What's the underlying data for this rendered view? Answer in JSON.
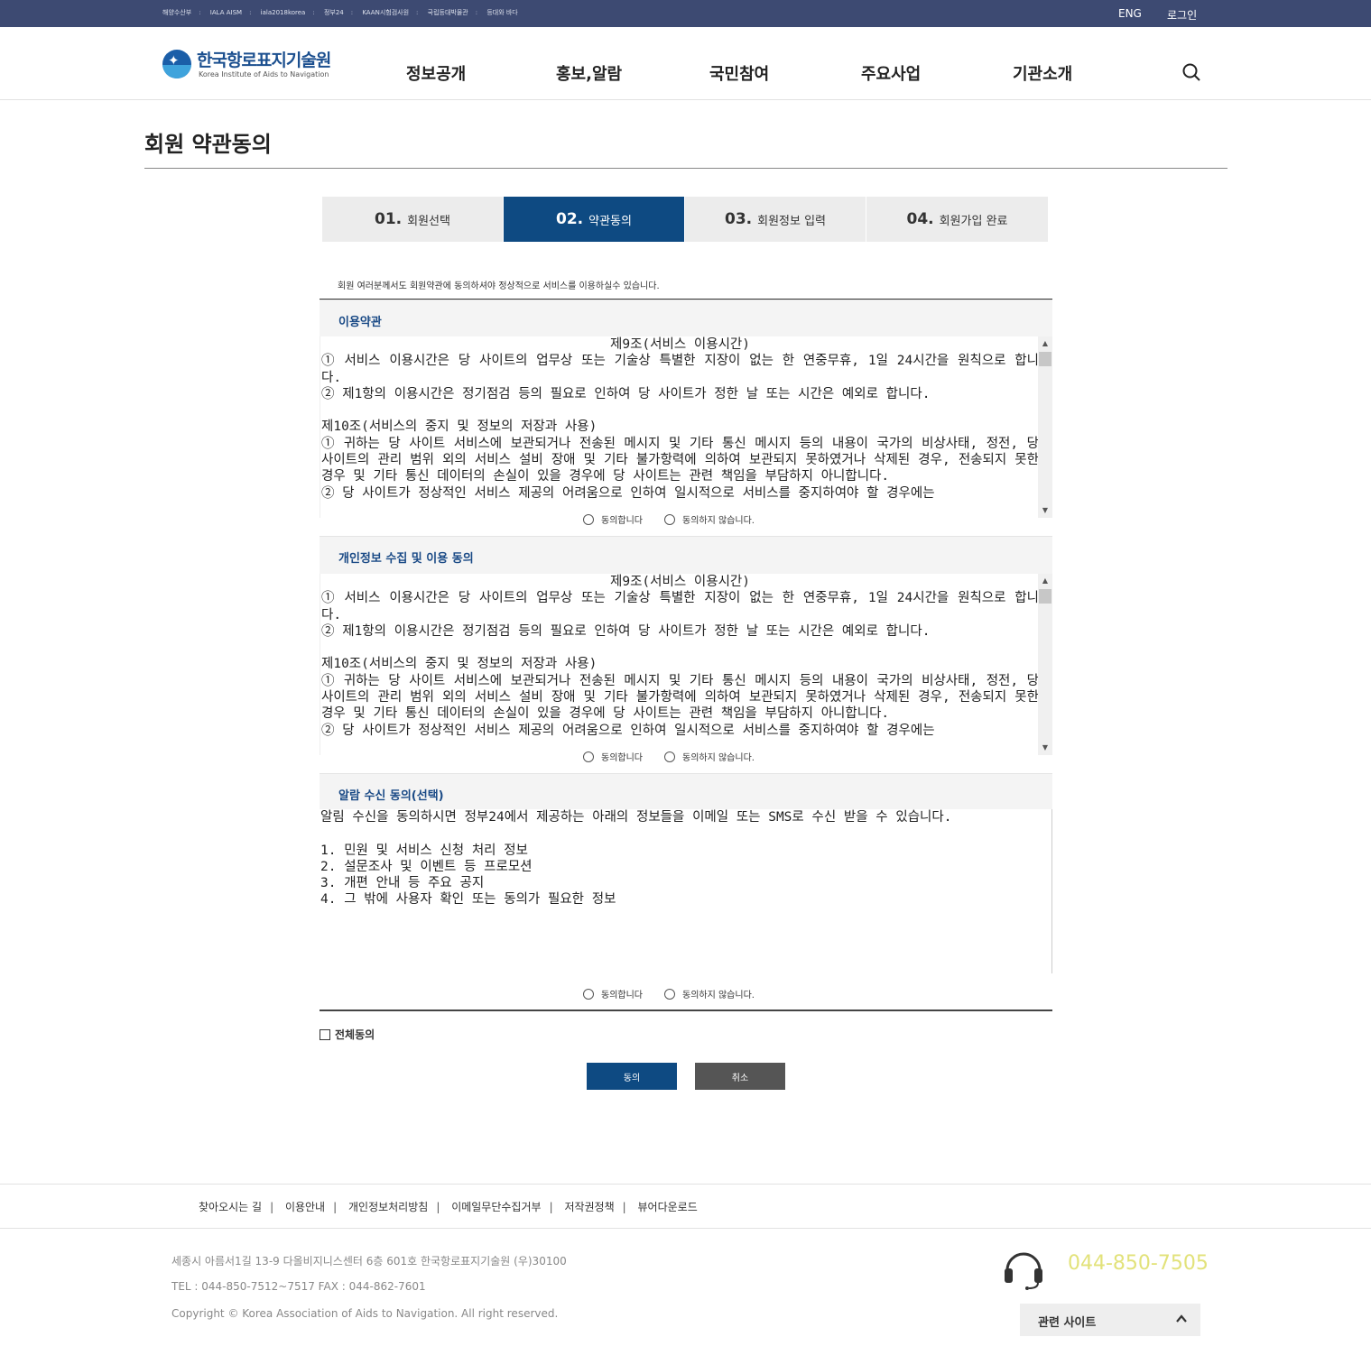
{
  "topbar": {
    "links": [
      "해양수산부",
      "IALA AISM",
      "iala2018korea",
      "정부24",
      "KAAN시험검사원",
      "국립등대박물관",
      "등대와 바다"
    ],
    "eng": "ENG",
    "login": "로그인"
  },
  "header": {
    "logo_ko": "한국항로표지기술원",
    "logo_en": "Korea Institute of Aids to Navigation",
    "menu": [
      "정보공개",
      "홍보,알람",
      "국민참여",
      "주요사업",
      "기관소개"
    ]
  },
  "page": {
    "title": "회원 약관동의"
  },
  "steps": [
    {
      "num": "01.",
      "label": "회원선택"
    },
    {
      "num": "02.",
      "label": "약관동의"
    },
    {
      "num": "03.",
      "label": "회원정보 입력"
    },
    {
      "num": "04.",
      "label": "회원가입 완료"
    }
  ],
  "intro": "회원 여러분께서도 회원약관에 동의하셔야 정상적으로 서비스를 이용하실수 있습니다.",
  "terms": {
    "heading": "이용약관",
    "center_line": "제9조(서비스 이용시간)",
    "body": "① 서비스 이용시간은 당 사이트의 업무상 또는 기술상 특별한 지장이 없는 한 연중무휴, 1일 24시간을 원칙으로 합니다.\n② 제1항의 이용시간은 정기점검 등의 필요로 인하여 당 사이트가 정한 날 또는 시간은 예외로 합니다.\n\n제10조(서비스의 중지 및 정보의 저장과 사용)\n① 귀하는 당 사이트 서비스에 보관되거나 전송된 메시지 및 기타 통신 메시지 등의 내용이 국가의 비상사태, 정전, 당 사이트의 관리 범위 외의 서비스 설비 장애 및 기타 불가항력에 의하여 보관되지 못하였거나 삭제된 경우, 전송되지 못한 경우 및 기타 통신 데이터의 손실이 있을 경우에 당 사이트는 관련 책임을 부담하지 아니합니다.\n② 당 사이트가 정상적인 서비스 제공의 어려움으로 인하여 일시적으로 서비스를 중지하여야 할 경우에는",
    "agree": "동의합니다",
    "disagree": "동의하지 않습니다."
  },
  "privacy": {
    "heading": "개인정보 수집 및 이용 동의",
    "center_line": "제9조(서비스 이용시간)",
    "body": "① 서비스 이용시간은 당 사이트의 업무상 또는 기술상 특별한 지장이 없는 한 연중무휴, 1일 24시간을 원칙으로 합니다.\n② 제1항의 이용시간은 정기점검 등의 필요로 인하여 당 사이트가 정한 날 또는 시간은 예외로 합니다.\n\n제10조(서비스의 중지 및 정보의 저장과 사용)\n① 귀하는 당 사이트 서비스에 보관되거나 전송된 메시지 및 기타 통신 메시지 등의 내용이 국가의 비상사태, 정전, 당 사이트의 관리 범위 외의 서비스 설비 장애 및 기타 불가항력에 의하여 보관되지 못하였거나 삭제된 경우, 전송되지 못한 경우 및 기타 통신 데이터의 손실이 있을 경우에 당 사이트는 관련 책임을 부담하지 아니합니다.\n② 당 사이트가 정상적인 서비스 제공의 어려움으로 인하여 일시적으로 서비스를 중지하여야 할 경우에는",
    "agree": "동의합니다",
    "disagree": "동의하지 않습니다."
  },
  "alarm": {
    "heading": "알람 수신 동의(선택)",
    "body": "알림 수신을 동의하시면 정부24에서 제공하는 아래의 정보들을 이메일 또는 SMS로 수신 받을 수 있습니다.\n\n1. 민원 및 서비스 신청 처리 정보\n2. 설문조사 및 이벤트 등 프로모션\n3. 개편 안내 등 주요 공지\n4. 그 밖에 사용자 확인 또는 동의가 필요한 정보",
    "agree": "동의합니다",
    "disagree": "동의하지 않습니다."
  },
  "all_agree": "전체동의",
  "buttons": {
    "agree": "동의",
    "cancel": "취소"
  },
  "footer": {
    "nav": [
      "찾아오시는 길",
      "이용안내",
      "개인정보처리방침",
      "이메일무단수집거부",
      "저작권정책",
      "뷰어다운로드"
    ],
    "address": "세종시 아름서1길 13-9 다올비지니스센터 6층 601호 한국항로표지기술원 (우)30100",
    "tel": "TEL : 044-850-7512~7517 FAX : 044-862-7601",
    "copyright": "Copyright © Korea Association of Aids to Navigation. All right reserved.",
    "phone": "044-850-7505",
    "related": "관련 사이트"
  }
}
